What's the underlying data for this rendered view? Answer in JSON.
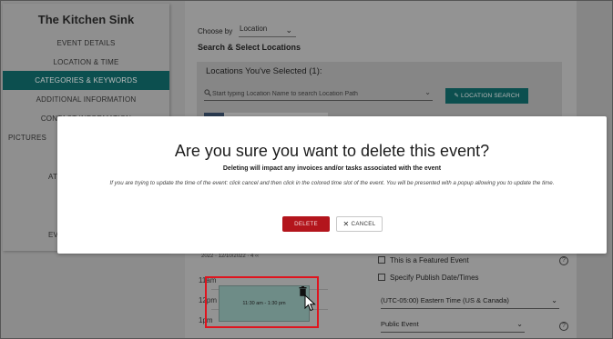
{
  "sidebar": {
    "title": "The Kitchen Sink",
    "items": [
      {
        "label": "EVENT DETAILS",
        "active": false
      },
      {
        "label": "LOCATION & TIME",
        "active": false
      },
      {
        "label": "CATEGORIES & KEYWORDS",
        "active": true
      },
      {
        "label": "ADDITIONAL INFORMATION",
        "active": false
      },
      {
        "label": "CONTACT INFORMATION",
        "active": false
      },
      {
        "label": "PICTURES",
        "active": false
      },
      {
        "label": "ATT",
        "active": false
      },
      {
        "label": "EV",
        "active": false
      }
    ]
  },
  "main": {
    "choose_by_label": "Choose by",
    "choose_by_value": "Location",
    "search_heading": "Search & Select Locations",
    "locations_title": "Locations You've Selected (1):",
    "location_search_placeholder": "Start typing Location Name to search Location Path",
    "location_search_button": "LOCATION SEARCH",
    "calendar": {
      "header_fragment": "2022 · 12/10/2022 · 4 ‹‹",
      "times": [
        "11am",
        "12pm",
        "1pm"
      ],
      "event_label": "11:30 am - 1:30 pm"
    },
    "featured_label": "This is a Featured Event",
    "publish_label": "Specify Publish Date/Times",
    "timezone_value": "(UTC-05:00) Eastern Time (US & Canada)",
    "visibility_value": "Public Event",
    "help_icon_glyph": "?"
  },
  "modal": {
    "title": "Are you sure you want to delete this event?",
    "subtitle": "Deleting will impact any invoices and/or tasks associated with the event",
    "info": "If you are trying to update the time of the event: click cancel and then click in the colored time slot of the event. You will be presented with a popup allowing you to update the time.",
    "delete_label": "DELETE",
    "cancel_label": "CANCEL"
  },
  "colors": {
    "accent_teal": "#0c4f4f",
    "delete_red": "#b3151c",
    "highlight_red": "#e0141e"
  },
  "icons": {
    "search": "search-icon",
    "chevron": "chevron-down-icon",
    "pencil": "pencil-icon",
    "trash": "trash-icon",
    "close": "close-icon",
    "help": "help-icon",
    "cursor": "mouse-cursor-icon"
  }
}
